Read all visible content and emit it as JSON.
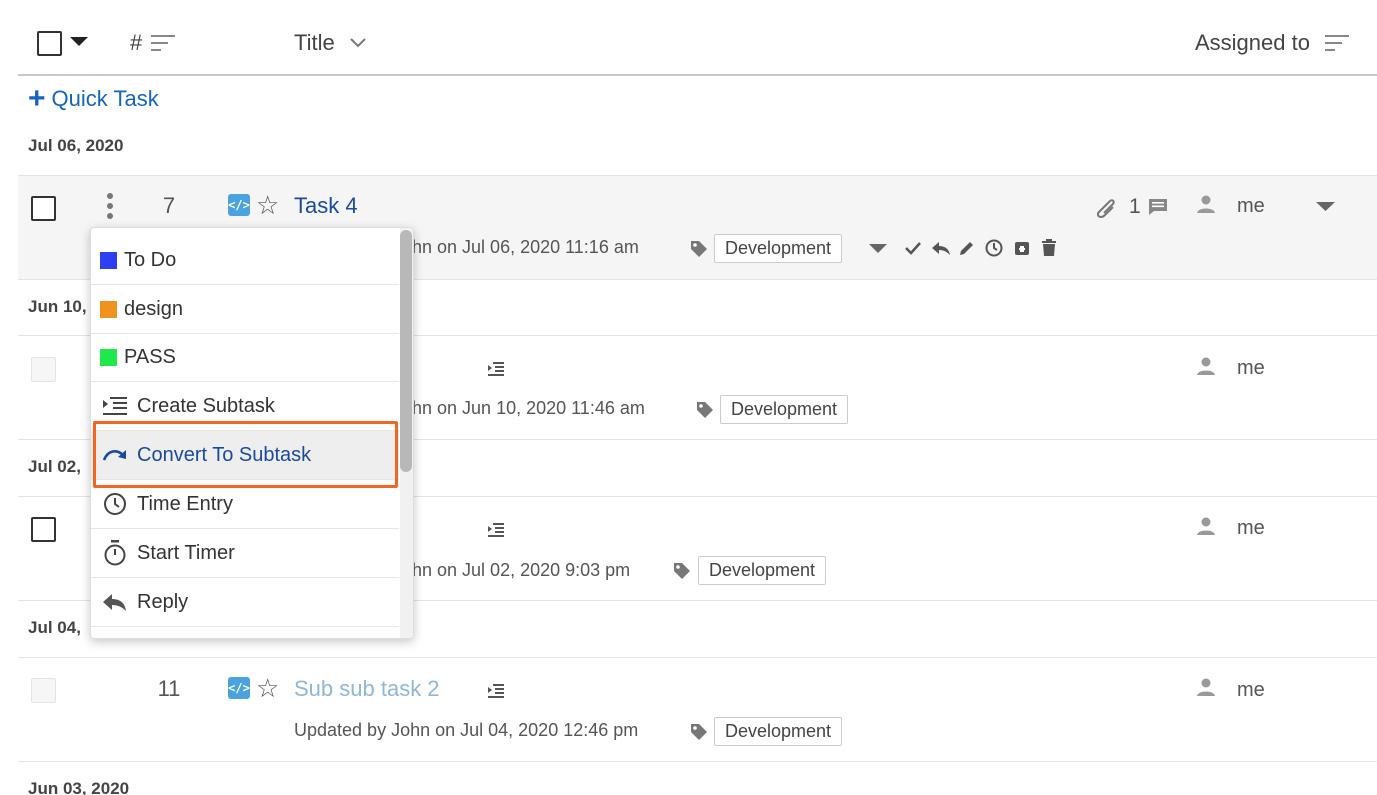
{
  "header": {
    "hash_label": "#",
    "title_label": "Title",
    "assigned_label": "Assigned to"
  },
  "quick_task": {
    "label": "Quick Task"
  },
  "groups": [
    {
      "date": "Jul 06, 2020"
    },
    {
      "date": "Jun 10,"
    },
    {
      "date": "Jul 02,"
    },
    {
      "date": "Jul 04,"
    },
    {
      "date": "Jun 03, 2020"
    }
  ],
  "tasks": [
    {
      "number": "7",
      "title": "Task 4",
      "meta": "hn  on Jul 06, 2020 11:16 am",
      "tag": "Development",
      "attachments": "1",
      "assignee": "me"
    },
    {
      "number": "",
      "title": "",
      "meta": "hn  on Jun 10, 2020 11:46 am",
      "tag": "Development",
      "assignee": "me"
    },
    {
      "number": "",
      "title": "",
      "meta": "hn on Jul 02, 2020 9:03 pm",
      "tag": "Development",
      "assignee": "me"
    },
    {
      "number": "11",
      "title": "Sub sub task 2",
      "meta": "Updated by John  on Jul 04, 2020 12:46 pm",
      "tag": "Development",
      "assignee": "me"
    }
  ],
  "menu": {
    "items": [
      {
        "label": "To Do",
        "color": "#2d3ff2"
      },
      {
        "label": "design",
        "color": "#f0921e"
      },
      {
        "label": "PASS",
        "color": "#1ee84a"
      },
      {
        "label": "Create Subtask",
        "icon": "indent-icon"
      },
      {
        "label": "Convert To Subtask",
        "icon": "curved-arrow-icon"
      },
      {
        "label": "Time Entry",
        "icon": "clock-icon"
      },
      {
        "label": "Start Timer",
        "icon": "stopwatch-icon"
      },
      {
        "label": "Reply",
        "icon": "reply-icon"
      }
    ]
  },
  "colors": {
    "accent_link": "#1565c0",
    "title_link": "#1a4a9c",
    "highlight_border": "#f26522"
  }
}
